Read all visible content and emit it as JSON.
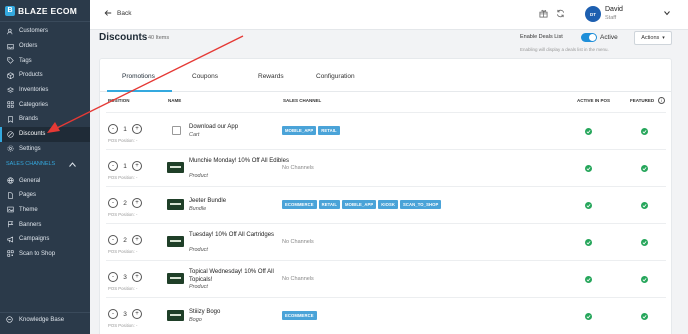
{
  "brand": {
    "name": "BLAZE ECOM",
    "logo_letter": "B"
  },
  "sidebar": {
    "items": [
      {
        "label": "Customers",
        "icon": "users-icon"
      },
      {
        "label": "Orders",
        "icon": "inbox-icon"
      },
      {
        "label": "Tags",
        "icon": "tag-icon"
      },
      {
        "label": "Products",
        "icon": "box-icon"
      },
      {
        "label": "Inventories",
        "icon": "layers-icon"
      },
      {
        "label": "Categories",
        "icon": "grid-icon"
      },
      {
        "label": "Brands",
        "icon": "bookmark-icon"
      },
      {
        "label": "Discounts",
        "icon": "percent-icon",
        "active": true
      },
      {
        "label": "Settings",
        "icon": "gear-icon"
      }
    ],
    "section_label": "SALES CHANNELS",
    "channel_items": [
      {
        "label": "General",
        "icon": "globe-icon"
      },
      {
        "label": "Pages",
        "icon": "file-icon"
      },
      {
        "label": "Theme",
        "icon": "image-icon"
      },
      {
        "label": "Banners",
        "icon": "flag-icon"
      },
      {
        "label": "Campaigns",
        "icon": "megaphone-icon"
      },
      {
        "label": "Scan to Shop",
        "icon": "qr-icon"
      }
    ],
    "knowledge_base": "Knowledge Base"
  },
  "topbar": {
    "back_label": "Back",
    "user": {
      "initials": "DT",
      "name": "David",
      "role": "Staff"
    }
  },
  "page": {
    "title": "Discounts",
    "count": "40 Items",
    "enable_deals_label": "Enable Deals List",
    "enable_deals_state": "Active",
    "enable_deals_help": "Enabling will display a deals list in the menu.",
    "actions_label": "Actions"
  },
  "tabs": [
    "Promotions",
    "Coupons",
    "Rewards",
    "Configuration"
  ],
  "columns": {
    "position": "POSITION",
    "name": "NAME",
    "sales_channel": "SALES CHANNEL",
    "active_in_pos": "ACTIVE IN POS",
    "featured": "FEATURED"
  },
  "pos_caption": "POS Position: -",
  "no_channels": "No Channels",
  "rows": [
    {
      "position": "1",
      "name": "Download our App",
      "type": "Cart",
      "thumb": "placeholder",
      "channels": [
        "MOBILE_APP",
        "RETAIL"
      ],
      "active_in_pos": true,
      "featured": true
    },
    {
      "position": "1",
      "name": "Munchie Monday! 10% Off All Edibles",
      "type": "Product",
      "thumb": "image",
      "channels": [],
      "active_in_pos": true,
      "featured": true
    },
    {
      "position": "2",
      "name": "Jeeter Bundle",
      "type": "Bundle",
      "thumb": "image",
      "channels": [
        "ECOMMERCE",
        "RETAIL",
        "MOBILE_APP",
        "KIOSK",
        "SCAN_TO_SHOP"
      ],
      "active_in_pos": true,
      "featured": true
    },
    {
      "position": "2",
      "name": "Tuesday! 10% Off All Cartridges",
      "type": "Product",
      "thumb": "image",
      "channels": [],
      "active_in_pos": true,
      "featured": true
    },
    {
      "position": "3",
      "name": "Topical Wednesday! 10% Off All Topicals!",
      "type": "Product",
      "thumb": "image",
      "channels": [],
      "active_in_pos": true,
      "featured": true
    },
    {
      "position": "3",
      "name": "Stiiizy Bogo",
      "type": "Bogo",
      "thumb": "image",
      "channels": [
        "ECOMMERCE"
      ],
      "active_in_pos": true,
      "featured": true
    }
  ],
  "colors": {
    "sidebar": "#2b3a4a",
    "accent": "#34a9df",
    "badge": "#4aa3d8",
    "check": "#26a65b",
    "arrow": "#e53935"
  }
}
